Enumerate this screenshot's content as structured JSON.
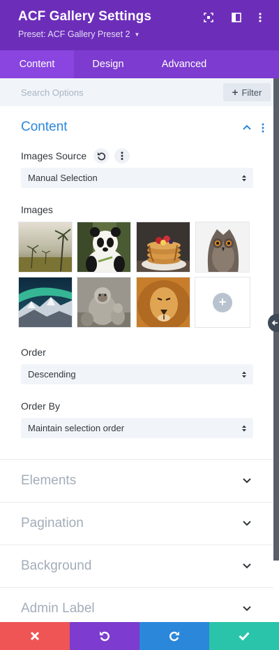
{
  "header": {
    "title": "ACF Gallery Settings",
    "preset": "Preset: ACF Gallery Preset 2",
    "icons": [
      "focus-icon",
      "split-view-icon",
      "more-options-icon"
    ]
  },
  "tabs": [
    {
      "label": "Content",
      "active": true
    },
    {
      "label": "Design",
      "active": false
    },
    {
      "label": "Advanced",
      "active": false
    }
  ],
  "search": {
    "placeholder": "Search Options",
    "filter_label": "Filter"
  },
  "content_section": {
    "title": "Content",
    "images_source": {
      "label": "Images Source",
      "value": "Manual Selection"
    },
    "images": {
      "label": "Images",
      "thumbnails": [
        "palm-grassland",
        "panda",
        "pancakes",
        "owl",
        "aurora-mountains",
        "monkeys",
        "lion"
      ]
    },
    "order": {
      "label": "Order",
      "value": "Descending"
    },
    "order_by": {
      "label": "Order By",
      "value": "Maintain selection order"
    }
  },
  "collapsed_sections": [
    "Elements",
    "Pagination",
    "Background",
    "Admin Label"
  ],
  "footer": [
    "cancel",
    "undo",
    "redo",
    "save"
  ],
  "colors": {
    "header": "#6c2eb9",
    "tabs": "#7d3bcf",
    "active_tab": "#8a45e0",
    "accent_blue": "#2b87da",
    "cancel": "#ef5555",
    "undo": "#7d3bcf",
    "redo": "#2b87da",
    "save": "#29c4a9"
  }
}
